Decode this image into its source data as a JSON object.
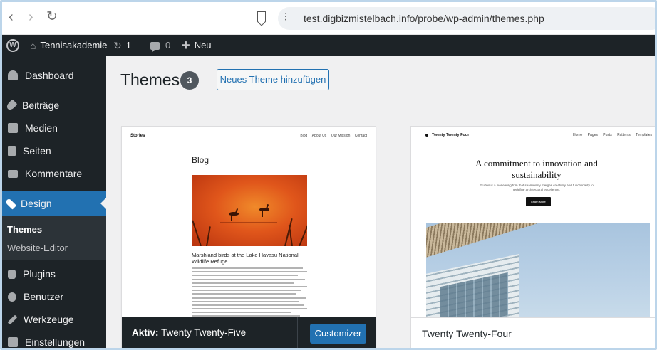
{
  "browser": {
    "url": "test.digbizmistelbach.info/probe/wp-admin/themes.php",
    "icons": [
      "back-icon",
      "forward-icon",
      "reload-icon",
      "bookmark-icon",
      "site-settings-icon"
    ]
  },
  "adminbar": {
    "site_name": "Tennisakademie",
    "updates_count": "1",
    "comments_count": "0",
    "new_label": "Neu"
  },
  "sidebar": {
    "items": [
      {
        "label": "Dashboard",
        "icon": "dashboard-icon"
      },
      {
        "label": "Beiträge",
        "icon": "pin-icon"
      },
      {
        "label": "Medien",
        "icon": "media-icon"
      },
      {
        "label": "Seiten",
        "icon": "page-icon"
      },
      {
        "label": "Kommentare",
        "icon": "comment-icon"
      },
      {
        "label": "Design",
        "icon": "brush-icon"
      },
      {
        "label": "Plugins",
        "icon": "plugin-icon"
      },
      {
        "label": "Benutzer",
        "icon": "user-icon"
      },
      {
        "label": "Werkzeuge",
        "icon": "wrench-icon"
      },
      {
        "label": "Einstellungen",
        "icon": "settings-icon"
      }
    ],
    "submenu": [
      {
        "label": "Themes"
      },
      {
        "label": "Website-Editor"
      }
    ],
    "active_color": "#2271b1"
  },
  "main": {
    "title": "Themes",
    "count": "3",
    "add_button": "Neues Theme hinzufügen",
    "themes": [
      {
        "active_prefix": "Aktiv:",
        "name": "Twenty Twenty-Five",
        "action": "Customizer",
        "preview": {
          "brand": "Stories",
          "nav": [
            "Blog",
            "About Us",
            "Our Mission",
            "Contact"
          ],
          "heading": "Blog",
          "caption": "Marshland birds at the Lake Havasu National Wildlife Refuge"
        }
      },
      {
        "name": "Twenty Twenty-Four",
        "preview": {
          "brand": "Twenty Twenty Four",
          "nav": [
            "Home",
            "Pages",
            "Posts",
            "Patterns",
            "Templates"
          ],
          "headline": "A commitment to innovation and sustainability",
          "subtext": "Études is a pioneering firm that seamlessly merges creativity and functionality to redefine architectural excellence.",
          "button": "Learn More"
        }
      }
    ]
  },
  "colors": {
    "admin_dark": "#1d2327",
    "accent": "#2271b1",
    "background": "#f0f0f1"
  }
}
